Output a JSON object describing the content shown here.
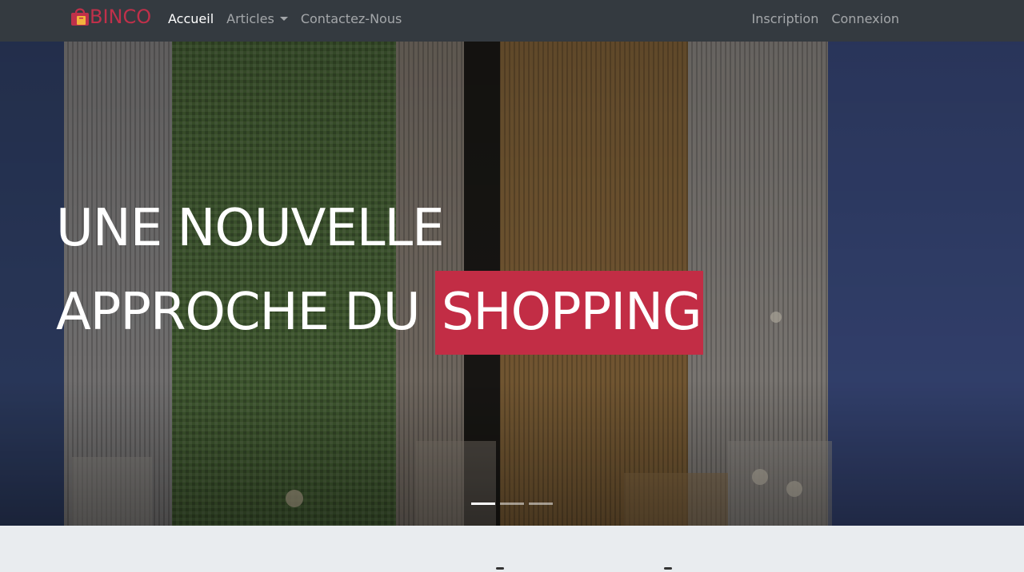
{
  "brand": {
    "logo_text": "BINCO",
    "color": "#c0304a"
  },
  "nav": {
    "home": "Accueil",
    "articles": "Articles",
    "contact": "Contactez-Nous",
    "signup": "Inscription",
    "login": "Connexion"
  },
  "hero": {
    "line1": "UNE NOUVELLE",
    "line2_prefix": "APPROCHE DU",
    "line2_highlight": "SHOPPING",
    "highlight_color": "#c22d45"
  },
  "carousel": {
    "slides": 3,
    "active": 1
  },
  "colors": {
    "navbar": "#343a40",
    "page_bg": "#e9ecef"
  }
}
